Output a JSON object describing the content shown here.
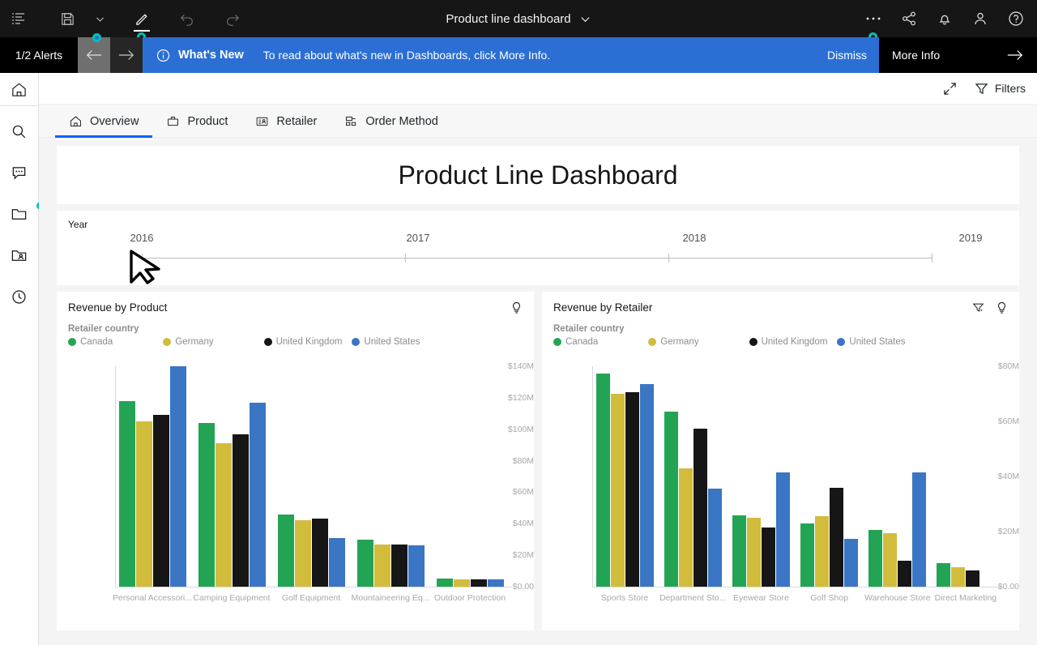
{
  "topbar": {
    "title": "Product line dashboard",
    "left_buttons": [
      {
        "name": "outline-icon",
        "label": "Outline"
      },
      {
        "name": "save-icon",
        "label": "Save"
      },
      {
        "name": "chevron-down-icon",
        "label": "Save options"
      },
      {
        "name": "edit-icon",
        "label": "Edit"
      },
      {
        "name": "undo-icon",
        "label": "Undo"
      },
      {
        "name": "redo-icon",
        "label": "Redo"
      }
    ],
    "right_buttons": [
      {
        "name": "overflow-menu-icon",
        "label": "More options"
      },
      {
        "name": "share-icon",
        "label": "Share"
      },
      {
        "name": "notification-bell-icon",
        "label": "Notifications"
      },
      {
        "name": "user-avatar-icon",
        "label": "Account"
      },
      {
        "name": "help-icon",
        "label": "Help"
      }
    ]
  },
  "notification": {
    "alerts_count": "1/2 Alerts",
    "prev_label": "Previous alert",
    "next_label": "Next alert",
    "badge": "What's New",
    "message": "To read about what's new in Dashboards, click More Info.",
    "dismiss": "Dismiss",
    "more_info": "More Info",
    "bg_color": "#2b6fd4"
  },
  "rail": {
    "items": [
      {
        "name": "home-icon",
        "label": "Home"
      },
      {
        "name": "search-icon",
        "label": "Search"
      },
      {
        "name": "chat-icon",
        "label": "Conversations"
      },
      {
        "name": "folder-icon",
        "label": "My content"
      },
      {
        "name": "team-folder-icon",
        "label": "Team content"
      },
      {
        "name": "recent-clock-icon",
        "label": "Recent"
      }
    ]
  },
  "toolbar": {
    "expand_label": "Expand",
    "filters_label": "Filters"
  },
  "tabs": [
    {
      "label": "Overview",
      "icon": "home-icon",
      "active": true
    },
    {
      "label": "Product",
      "icon": "briefcase-icon",
      "active": false
    },
    {
      "label": "Retailer",
      "icon": "id-card-icon",
      "active": false
    },
    {
      "label": "Order Method",
      "icon": "layout-icon",
      "active": false
    }
  ],
  "dashboard": {
    "title": "Product Line Dashboard",
    "slider": {
      "label": "Year",
      "ticks": [
        "2016",
        "2017",
        "2018",
        "2019"
      ]
    }
  },
  "legend_title": "Retailer country",
  "series_colors": {
    "Canada": "#23a455",
    "Germany": "#d2bc3c",
    "United Kingdom": "#161616",
    "United States": "#3a76c4"
  },
  "chart_data": [
    {
      "type": "bar",
      "title": "Revenue by Product",
      "xlabel": "",
      "ylabel": "",
      "ylim": [
        0,
        140000000
      ],
      "yticks": [
        "$0.00",
        "$20M",
        "$40M",
        "$60M",
        "$80M",
        "$100M",
        "$120M",
        "$140M"
      ],
      "ytick_values": [
        0,
        20000000,
        40000000,
        60000000,
        80000000,
        100000000,
        120000000,
        140000000
      ],
      "grid": false,
      "legend_position": "top-left",
      "legend_title": "Retailer country",
      "categories": [
        "Personal Accessori...",
        "Camping Equipment",
        "Golf Equipment",
        "Mountaineering Eq...",
        "Outdoor Protection"
      ],
      "series": [
        {
          "name": "Canada",
          "color": "#23a455",
          "values": [
            118000000,
            104000000,
            46000000,
            30000000,
            5000000
          ]
        },
        {
          "name": "Germany",
          "color": "#d2bc3c",
          "values": [
            105000000,
            91000000,
            42000000,
            27000000,
            4500000
          ]
        },
        {
          "name": "United Kingdom",
          "color": "#161616",
          "values": [
            109000000,
            97000000,
            43000000,
            27000000,
            4500000
          ]
        },
        {
          "name": "United States",
          "color": "#3a76c4",
          "values": [
            140000000,
            117000000,
            31000000,
            26000000,
            4500000
          ]
        }
      ],
      "icons": [
        "lightbulb-icon"
      ]
    },
    {
      "type": "bar",
      "title": "Revenue by Retailer",
      "xlabel": "",
      "ylabel": "",
      "ylim": [
        0,
        80000000
      ],
      "yticks": [
        "$0.00",
        "$20M",
        "$40M",
        "$60M",
        "$80M"
      ],
      "ytick_values": [
        0,
        20000000,
        40000000,
        60000000,
        80000000
      ],
      "grid": false,
      "legend_position": "top-left",
      "legend_title": "Retailer country",
      "categories": [
        "Sports Store",
        "Department Sto...",
        "Eyewear Store",
        "Golf Shop",
        "Warehouse Store",
        "Direct Marketing"
      ],
      "series": [
        {
          "name": "Canada",
          "color": "#23a455",
          "values": [
            77500000,
            63500000,
            26000000,
            23000000,
            20500000,
            8500000
          ]
        },
        {
          "name": "Germany",
          "color": "#d2bc3c",
          "values": [
            70000000,
            43000000,
            25000000,
            25500000,
            19500000,
            7000000
          ]
        },
        {
          "name": "United Kingdom",
          "color": "#161616",
          "values": [
            70500000,
            57500000,
            21500000,
            36000000,
            9500000,
            6000000
          ]
        },
        {
          "name": "United States",
          "color": "#3a76c4",
          "values": [
            73500000,
            35500000,
            41500000,
            17500000,
            41500000,
            0
          ]
        }
      ],
      "icons": [
        "filter-icon",
        "lightbulb-icon"
      ]
    }
  ]
}
